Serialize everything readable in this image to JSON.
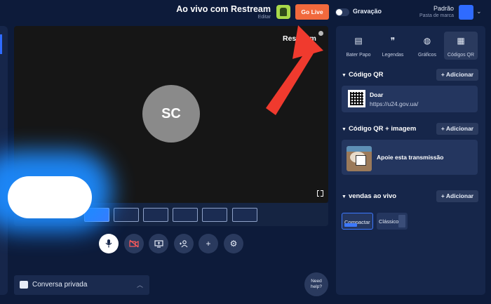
{
  "header": {
    "title": "Ao vivo com Restream",
    "edit_label": "Editar",
    "go_live_label": "Go Live",
    "recording_label": "Gravação",
    "profile_name": "Padrão",
    "profile_sub": "Pasta de marca"
  },
  "stage": {
    "avatar_initials": "SC",
    "watermark": "Restream"
  },
  "chat": {
    "label": "Conversa privada"
  },
  "help": {
    "line1": "Need",
    "line2": "help?"
  },
  "panel": {
    "tabs": [
      {
        "label": "Bater Papo",
        "icon": "chat-icon"
      },
      {
        "label": "Legendas",
        "icon": "quote-icon"
      },
      {
        "label": "Gráficos",
        "icon": "palette-icon"
      },
      {
        "label": "Códigos QR",
        "icon": "qr-code-icon"
      }
    ],
    "active_tab": "Códigos QR",
    "sections": {
      "qr": {
        "title": "Código QR",
        "add_label": "+ Adicionar"
      },
      "qr_image": {
        "title": "Código QR + imagem",
        "add_label": "+ Adicionar"
      },
      "live_sales": {
        "title": "vendas ao vivo",
        "add_label": "+ Adicionar"
      }
    },
    "qr_item": {
      "title": "Doar",
      "url": "https://u24.gov.ua/"
    },
    "qr_image_item": {
      "title": "Apoie esta transmissão"
    },
    "styles": {
      "compact": "Compactar",
      "classic": "Clássico"
    }
  },
  "colors": {
    "background": "#0d1b3a",
    "panel": "#16264a",
    "accent": "#2f6bff",
    "go_live": "#f1693d",
    "annotation_arrow": "#f03a2e",
    "highlight_glow": "#1d8bff"
  }
}
